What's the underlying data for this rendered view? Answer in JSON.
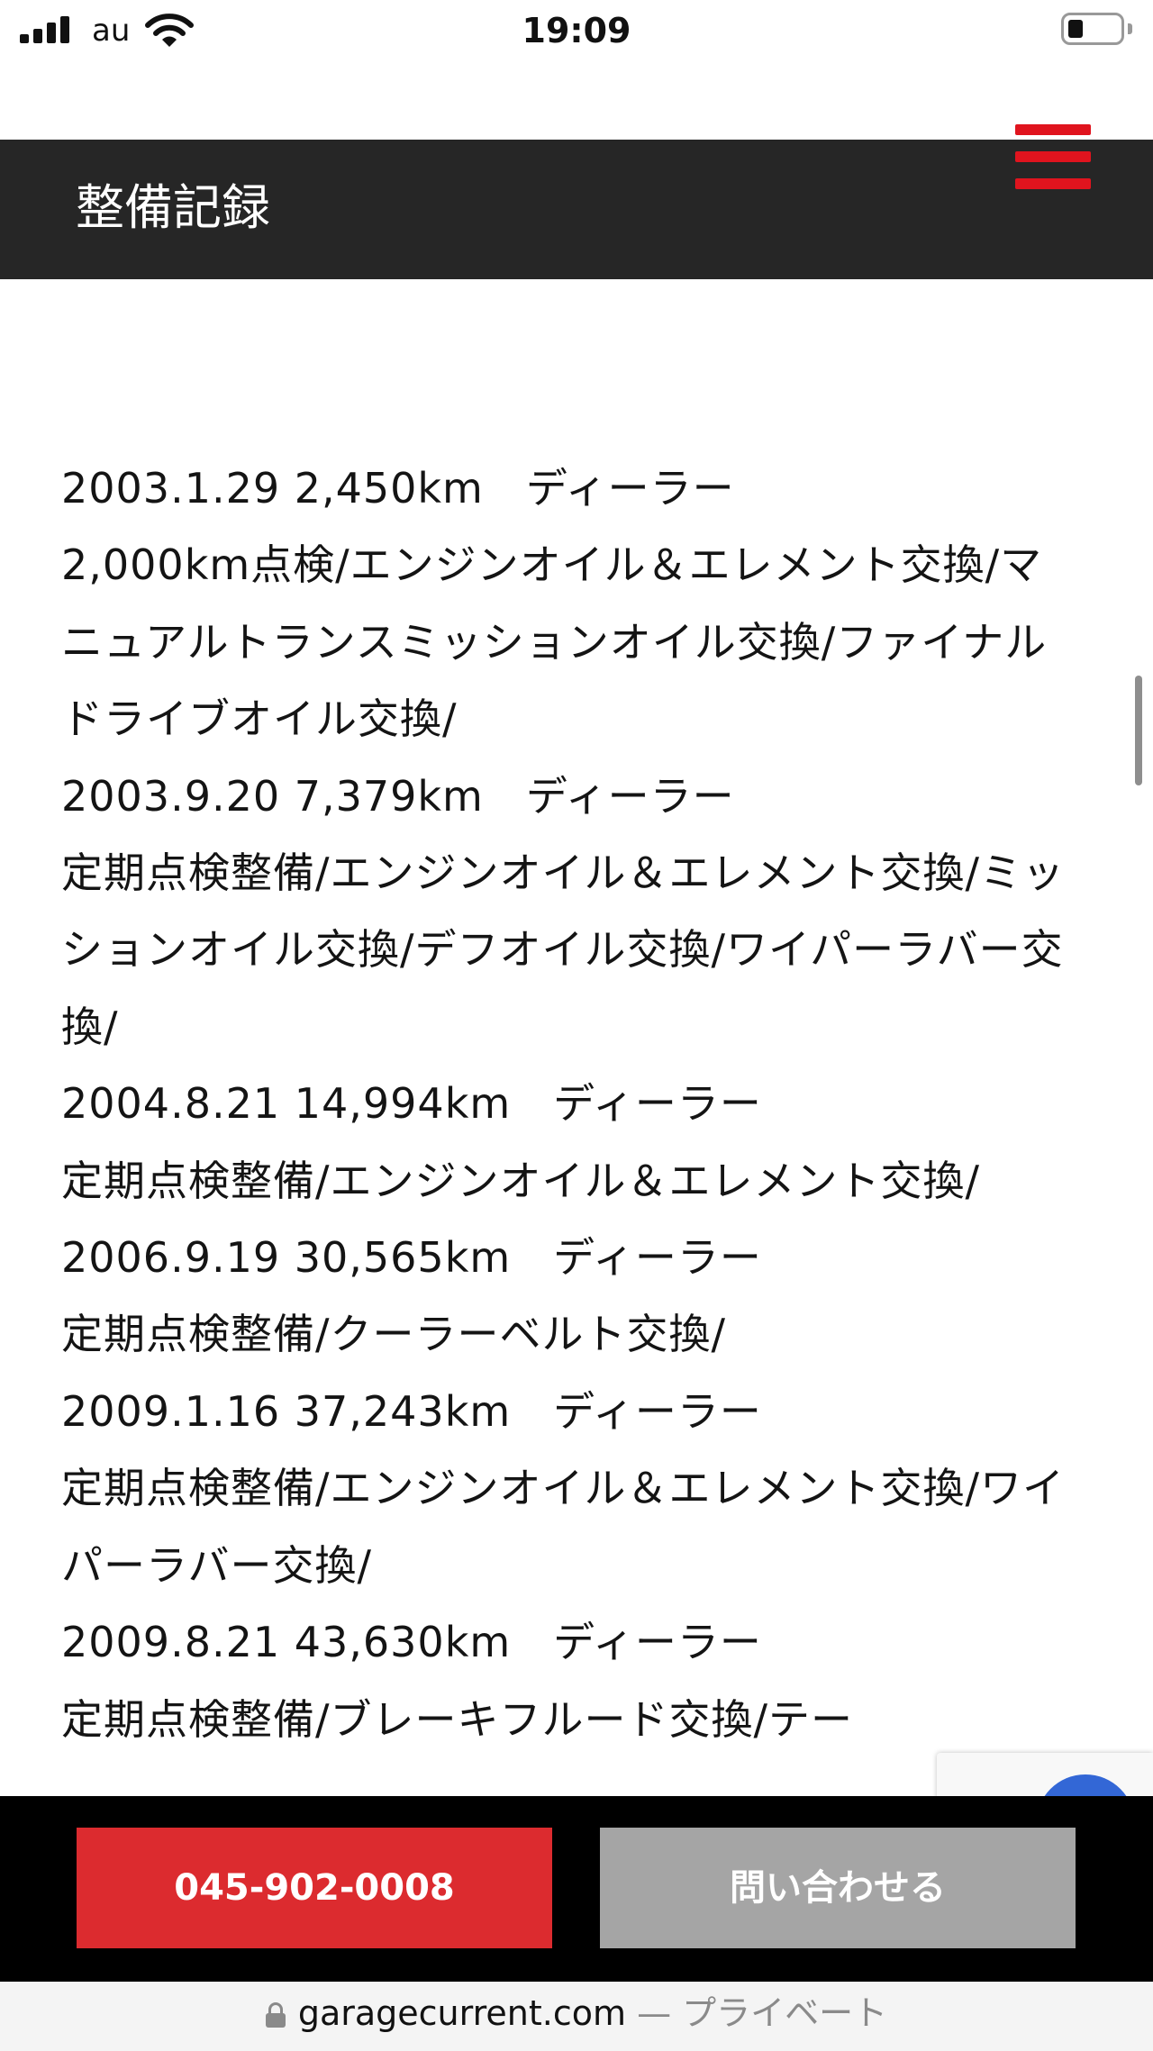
{
  "status_bar": {
    "carrier": "au",
    "time": "19:09"
  },
  "header": {
    "title": "整備記録"
  },
  "records": [
    "2003.1.29 2,450km　ディーラー",
    "2,000km点検/エンジンオイル＆エレメント交換/マニュアルトランスミッションオイル交換/ファイナルドライブオイル交換/",
    "2003.9.20 7,379km　ディーラー",
    "定期点検整備/エンジンオイル＆エレメント交換/ミッションオイル交換/デフオイル交換/ワイパーラバー交換/",
    "2004.8.21 14,994km　ディーラー",
    "定期点検整備/エンジンオイル＆エレメント交換/",
    "2006.9.19 30,565km　ディーラー",
    "定期点検整備/クーラーベルト交換/",
    "2009.1.16 37,243km　ディーラー",
    "定期点検整備/エンジンオイル＆エレメント交換/ワイパーラバー交換/",
    "2009.8.21  43,630km　ディーラー",
    "定期点検整備/ブレーキフルード交換/テー"
  ],
  "cta": {
    "phone_label": "045-902-0008",
    "contact_label": "問い合わせる",
    "call_color": "#dc2b2f",
    "contact_color": "#a5a5a5"
  },
  "url_bar": {
    "domain": "garagecurrent.com",
    "suffix": " — プライベート"
  },
  "icons": {
    "menu": "hamburger-icon",
    "lock": "lock-icon",
    "wifi": "wifi-icon",
    "battery": "battery-icon"
  },
  "colors": {
    "header_bg": "#262626",
    "accent": "#e0141e"
  }
}
